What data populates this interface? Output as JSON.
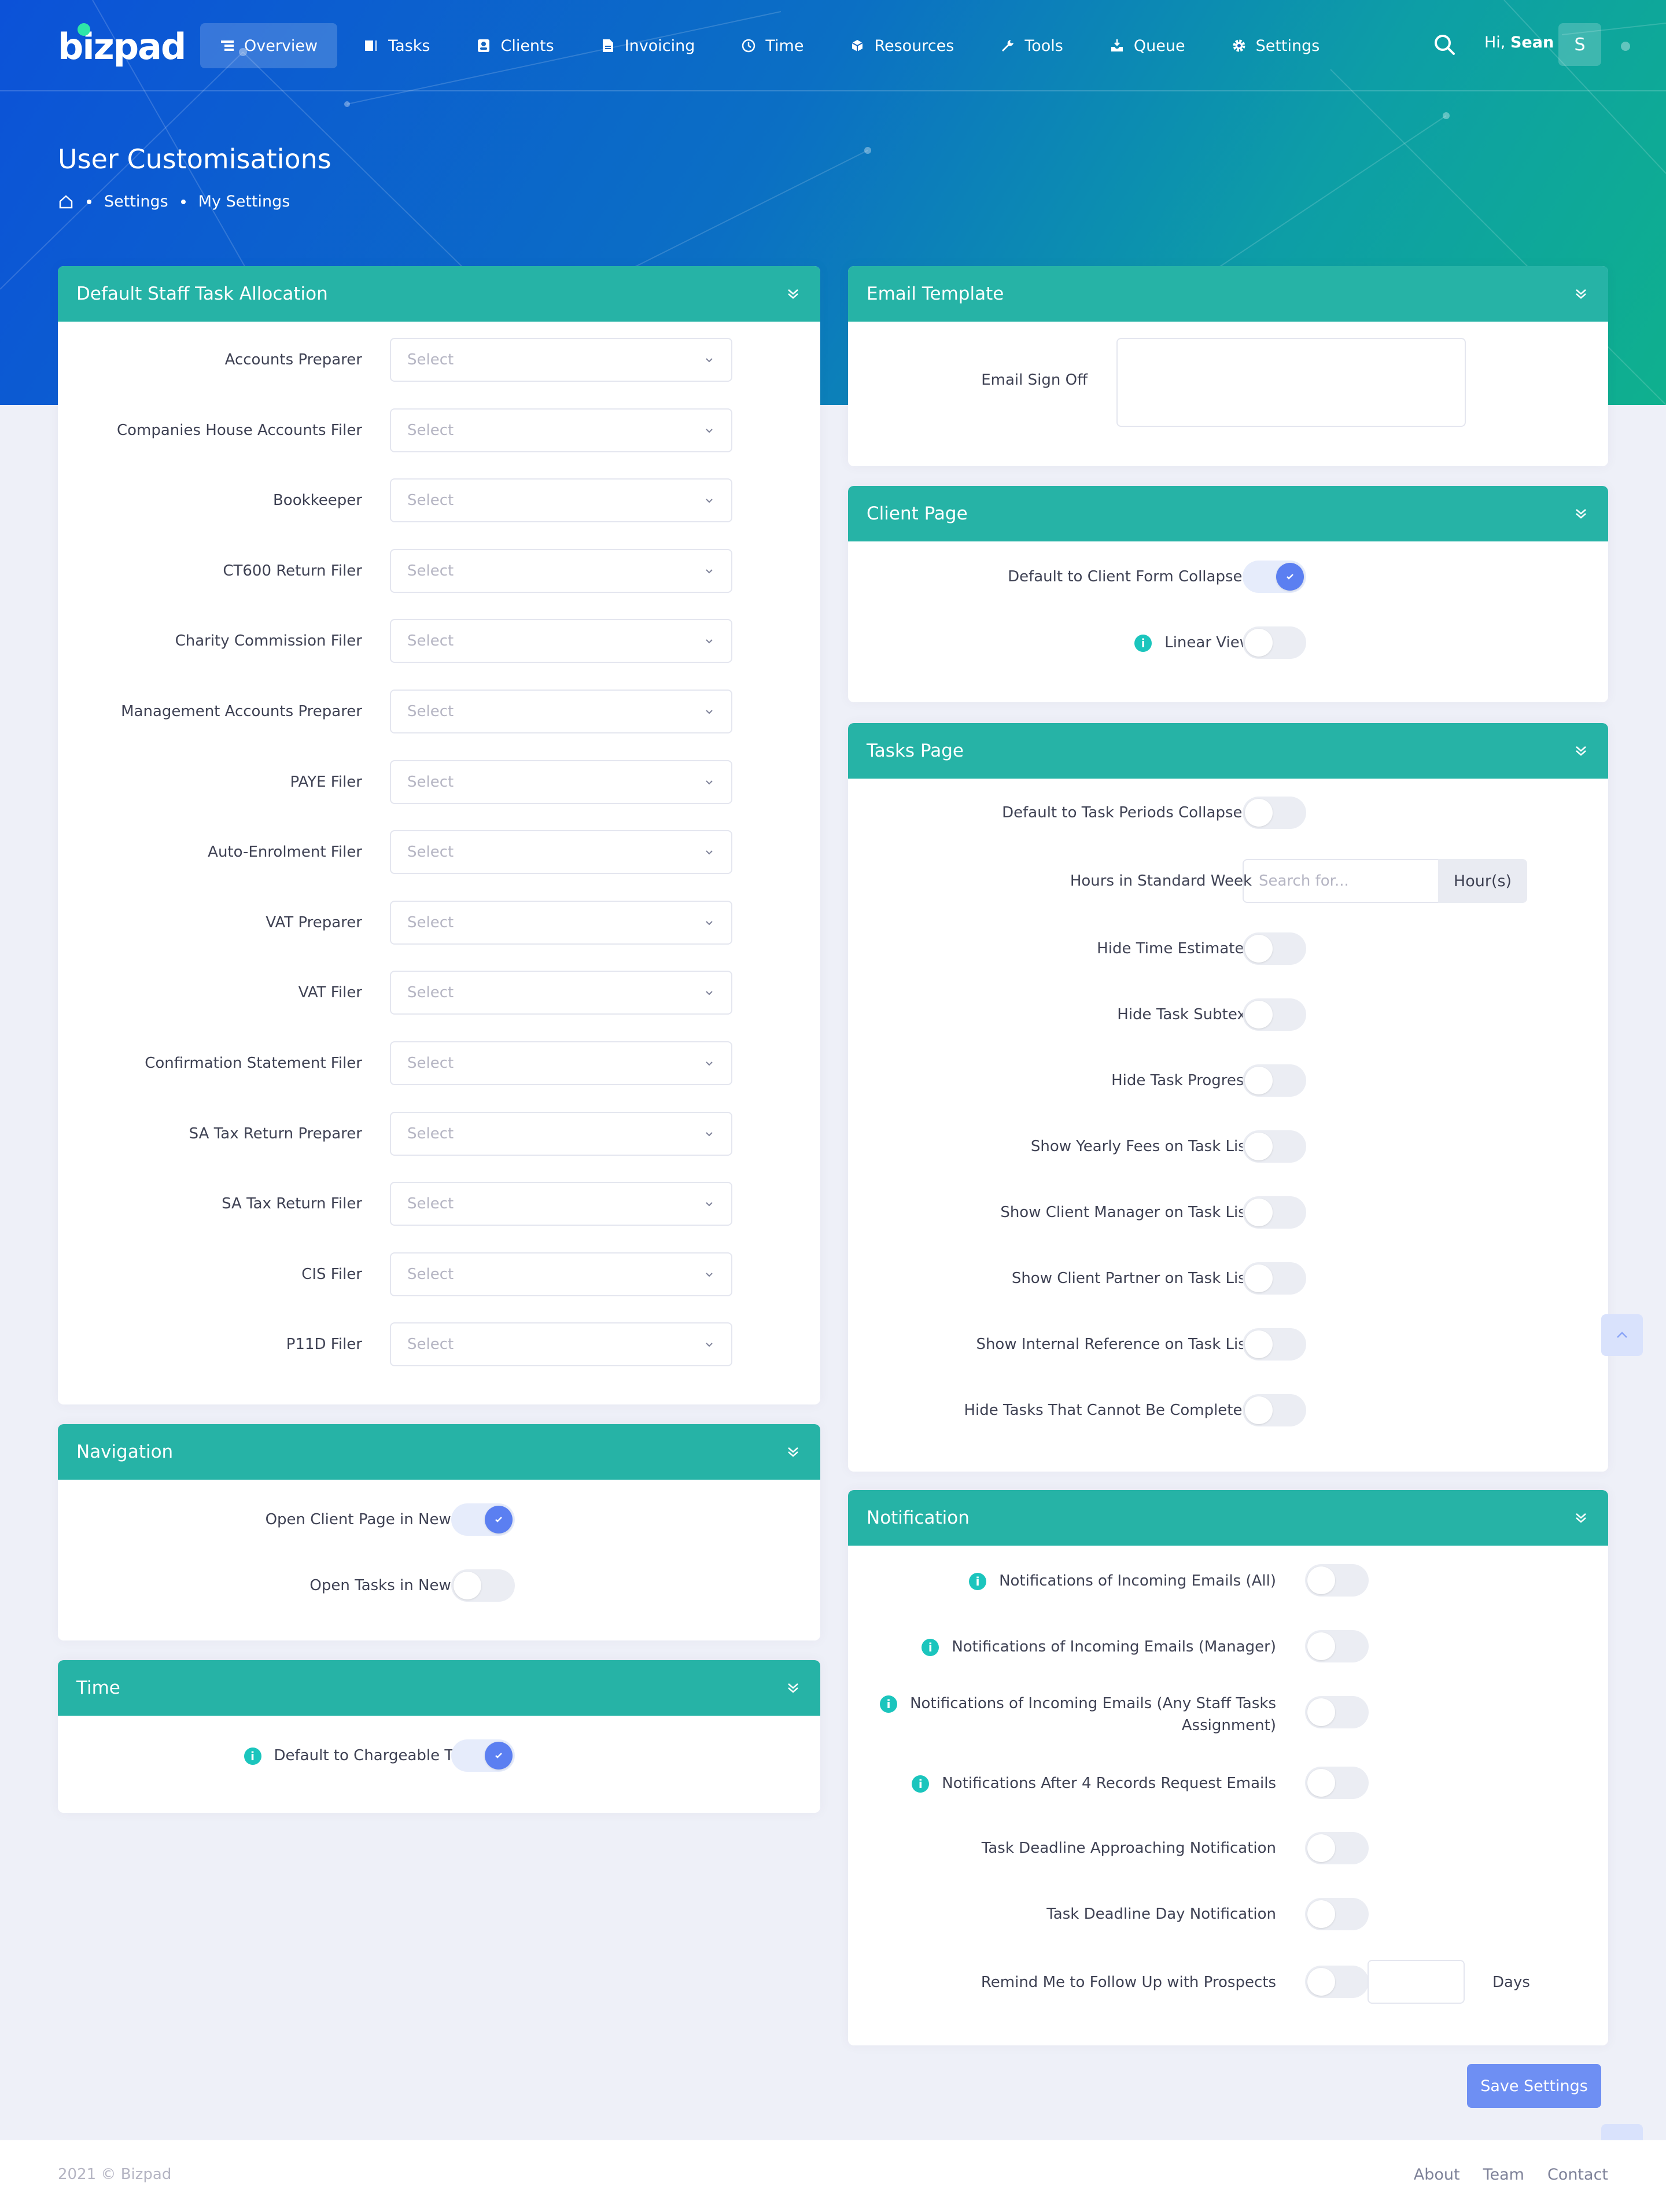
{
  "brand": {
    "logo_text": "bizpad"
  },
  "nav": {
    "items": [
      {
        "label": "Overview",
        "icon": "list-icon",
        "active": true
      },
      {
        "label": "Tasks",
        "icon": "task-icon"
      },
      {
        "label": "Clients",
        "icon": "client-card-icon"
      },
      {
        "label": "Invoicing",
        "icon": "invoice-icon"
      },
      {
        "label": "Time",
        "icon": "clock-icon"
      },
      {
        "label": "Resources",
        "icon": "box-icon"
      },
      {
        "label": "Tools",
        "icon": "wrench-icon"
      },
      {
        "label": "Queue",
        "icon": "inbox-icon"
      },
      {
        "label": "Settings",
        "icon": "gear-icon"
      }
    ],
    "greeting_prefix": "Hi,",
    "user_name": "Sean",
    "avatar_initial": "S"
  },
  "page": {
    "title": "User Customisations",
    "breadcrumb": [
      "Settings",
      "My Settings"
    ]
  },
  "staff_allocation": {
    "title": "Default Staff Task Allocation",
    "placeholder": "Select",
    "fields": [
      "Accounts Preparer",
      "Companies House Accounts Filer",
      "Bookkeeper",
      "CT600 Return Filer",
      "Charity Commission Filer",
      "Management Accounts Preparer",
      "PAYE Filer",
      "Auto-Enrolment Filer",
      "VAT Preparer",
      "VAT Filer",
      "Confirmation Statement Filer",
      "SA Tax Return Preparer",
      "SA Tax Return Filer",
      "CIS Filer",
      "P11D Filer"
    ]
  },
  "navigation": {
    "title": "Navigation",
    "open_client_label": "Open Client Page in New Tab",
    "open_client_on": true,
    "open_tasks_label": "Open Tasks in New Tab",
    "open_tasks_on": false
  },
  "time": {
    "title": "Time",
    "chargeable_label": "Default to Chargeable Time",
    "chargeable_on": true
  },
  "email_template": {
    "title": "Email Template",
    "sign_off_label": "Email Sign Off",
    "sign_off_value": ""
  },
  "client_page": {
    "title": "Client Page",
    "collapsed_label": "Default to Client Form Collapsed",
    "collapsed_on": true,
    "linear_label": "Linear View",
    "linear_on": false
  },
  "tasks_page": {
    "title": "Tasks Page",
    "periods_label": "Default to Task Periods Collapsed",
    "hours_label": "Hours in Standard Week",
    "hours_placeholder": "Search for...",
    "hours_unit": "Hour(s)",
    "toggles": [
      "Hide Time Estimates",
      "Hide Task Subtext",
      "Hide Task Progress",
      "Show Yearly Fees on Task List",
      "Show Client Manager on Task List",
      "Show Client Partner on Task List",
      "Show Internal Reference on Task List",
      "Hide Tasks That Cannot Be Completed"
    ]
  },
  "notification": {
    "title": "Notification",
    "n1": "Notifications of Incoming Emails (All)",
    "n2": "Notifications of Incoming Emails (Manager)",
    "n3a": "Notifications of Incoming Emails (Any Staff Tasks",
    "n3b": "Assignment)",
    "n4": "Notifications After 4 Records Request Emails",
    "n5": "Task Deadline Approaching Notification",
    "n6": "Task Deadline Day Notification",
    "n7": "Remind Me to Follow Up with Prospects",
    "days_unit": "Days"
  },
  "actions": {
    "save_label": "Save Settings"
  },
  "footer": {
    "copyright": "2021 © Bizpad",
    "links": [
      "About",
      "Team",
      "Contact"
    ]
  },
  "colors": {
    "primary": "#26b3a6",
    "accent": "#5b7ff1",
    "hero_from": "#0c52d8",
    "hero_to": "#0fb08e"
  }
}
